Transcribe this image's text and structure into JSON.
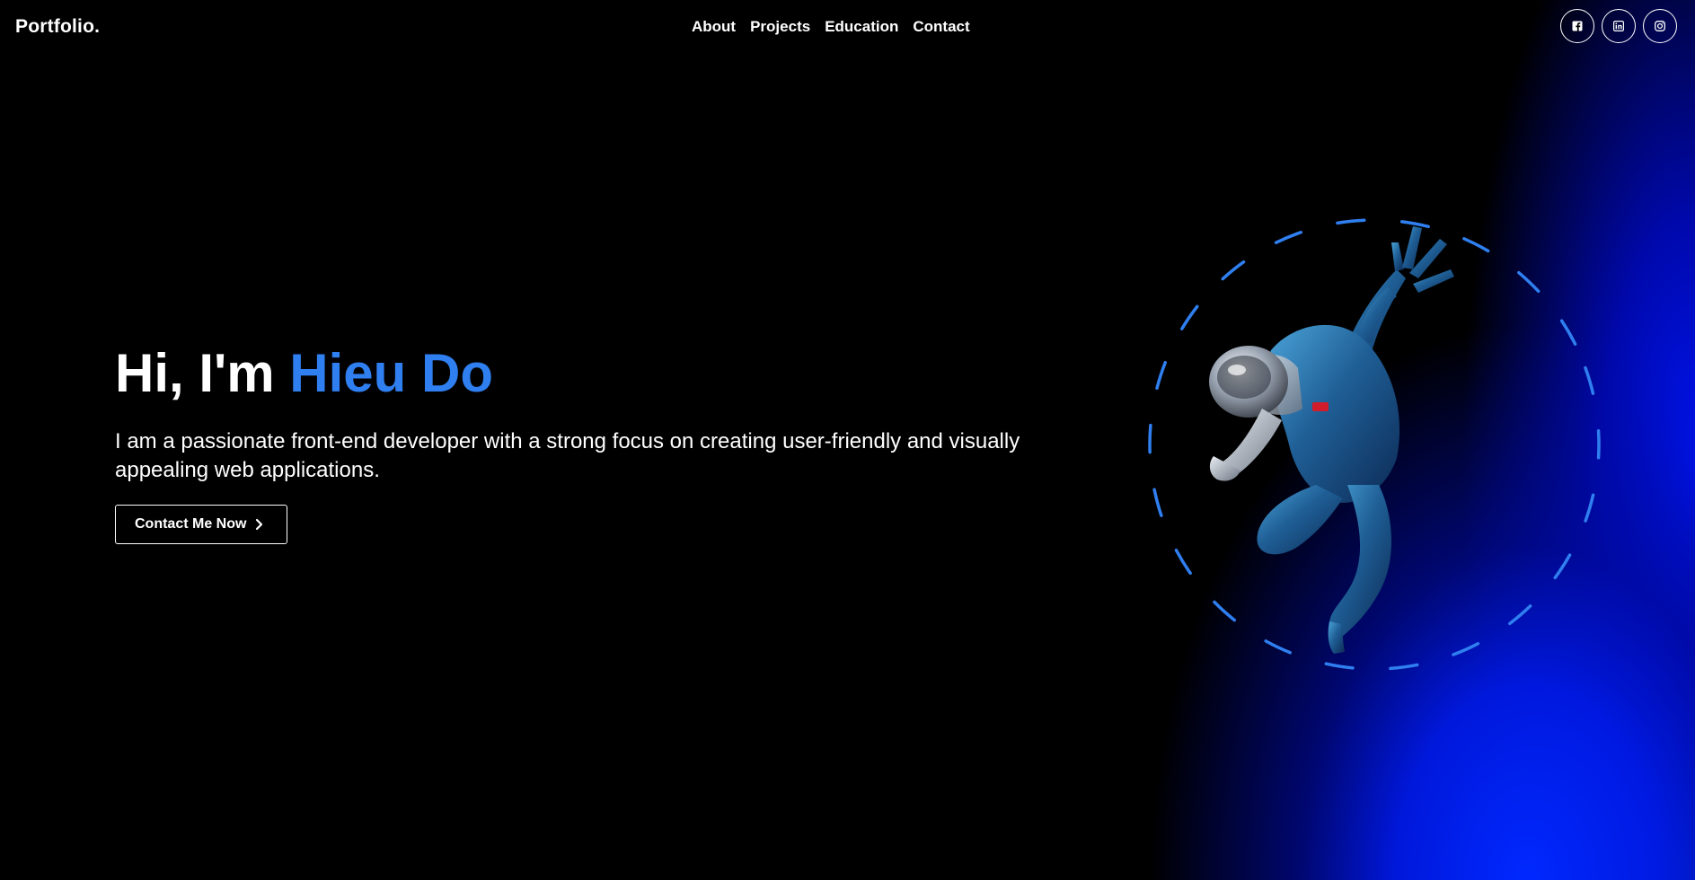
{
  "header": {
    "brand": "Portfolio.",
    "nav": [
      {
        "label": "About"
      },
      {
        "label": "Projects"
      },
      {
        "label": "Education"
      },
      {
        "label": "Contact"
      }
    ],
    "socials": [
      {
        "icon": "facebook-icon"
      },
      {
        "icon": "linkedin-icon"
      },
      {
        "icon": "instagram-icon"
      }
    ]
  },
  "hero": {
    "greeting": "Hi, I'm ",
    "name": "Hieu Do",
    "description": "I am a passionate front-end developer with a strong focus on creating user-friendly and visually appealing web applications.",
    "cta_label": "Contact Me Now",
    "cta_icon": "chevron-right-icon"
  },
  "colors": {
    "background": "#000000",
    "accent": "#2f7ff0",
    "glow": "#0020ff",
    "text": "#ffffff"
  },
  "illustration": {
    "icon": "jumping-hero-figure-icon"
  }
}
